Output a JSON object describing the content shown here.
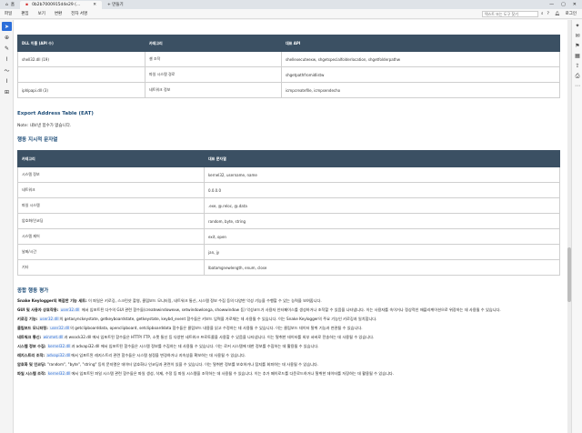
{
  "titlebar": {
    "home_tab": "홈",
    "doc_tab": "0b2b7000915d4e29 (...",
    "new_tab": "+ 만들기"
  },
  "menubar": {
    "items": [
      "파일",
      "편집",
      "보기",
      "변환",
      "전자 서명"
    ],
    "search_placeholder": "텍스트 또는 도구 찾기",
    "login": "로그인"
  },
  "dll_table": {
    "headers": [
      "DLL 이름 (API 수)",
      "카테고리",
      "대표 API"
    ],
    "rows": [
      [
        "shell32.dll (19)",
        "셸 조작",
        "shellexecuteexw, shgetspecialfolderlocation, shgetfolderpathw"
      ],
      [
        "",
        "파일 시스템 경로",
        "shgetpathfromidlistw"
      ],
      [
        "iphlpapi.dll (3)",
        "네트워크 정보",
        "icmpcreatefile, icmpsendecho"
      ]
    ]
  },
  "eat": {
    "heading": "Export Address Table (EAT)",
    "note": "Note: 내보낸 함수가 없습니다."
  },
  "behavior": {
    "heading": "행동 지시적 문자열",
    "headers": [
      "카테고리",
      "대표 문자열"
    ],
    "rows": [
      [
        "시스템 정보",
        "kernel32, username, name"
      ],
      [
        "네트워크",
        "0.0.0.0"
      ],
      [
        "파일 시스템",
        ".exe, @.reloc, @.data"
      ],
      [
        "암호화/인코딩",
        "random, byte, string"
      ],
      [
        "시스템 제어",
        "exit, open"
      ],
      [
        "날짜/시간",
        "jan, jy"
      ],
      [
        "기타",
        "lbatamgnewlength, enum, close"
      ]
    ]
  },
  "summary": {
    "heading": "종합 행동 평가",
    "paragraphs": [
      {
        "label": "Snake Keylogger의 복잡한 기능 세트:",
        "text": " 이 파일은 키로깅, 스크린샷 촬영, 클립보드 모니터링, 네트워크 통신, 시스템 정보 수집 등의 다양한 악성 기능을 수행할 수 있는 능력을 보여줍니다."
      },
      {
        "label": "GUI 및 사용자 상호작용:",
        "code": "user32.dll",
        "text": "에서 임포트된 다수의 GUI 관련 함수들(createwindowexw, setwindowlonga, showwindow 등) 악성코드가 사용자 인터페이스를 생성하거나 조작할 수 있음을 나타냅니다. 이는 사용자를 속이거나 정상적인 애플리케이션으로 위장하는 데 사용될 수 있습니다."
      },
      {
        "label": "키로깅 기능:",
        "code": "user32.dll",
        "text": "의 getasynckeystate, getkeyboardstate, getkeystate, keybd_event 함수들은 키보드 입력을 가로채는 데 사용될 수 있습니다. 이는 Snake Keylogger의 주요 기능인 키로깅과 일치합니다."
      },
      {
        "label": "클립보드 모니터링:",
        "code": "user32.dll",
        "text": "의 getclipboarddata, openclipboard, setclipboarddata 함수들은 클립보드 내용을 읽고 수정하는 데 사용될 수 있습니다. 이는 클립보드 데이터 탈취 기능과 연관될 수 있습니다."
      },
      {
        "label": "네트워크 통신:",
        "code": "winmet.dll",
        "text": "과 wsock32.dll 에서 임포트된 함수들은 HTTP/ FTP, 소켓 통신 등 다양한 네트워크 프로토콜을 사용할 수 있음을 나타냅니다. 이는 탈취한 데이터를 외부 서버로 전송하는 데 사용될 수 있습니다."
      },
      {
        "label": "시스템 정보 수집:",
        "code": "kernel32.dll",
        "text": "과 advapi32.dll 에서 임포트된 함수들은 시스템 정보를 수집하는 데 사용될 수 있습니다. 이는 로커 시스템에 대한 정보를 수집하는 데 활용될 수 있습니다."
      },
      {
        "label": "레지스트리 조작:",
        "code": "advapi32.dll",
        "text": "에서 임포트된 레지스트리 관련 함수들은 시스템 설정을 변경하거나 지속성을 확보하는 데 사용될 수 있습니다."
      },
      {
        "label": "암호화 및 인코딩:",
        "code": "",
        "text": "\"random\", \"byte\", \"string\" 등의 문자열은 데이터 암호화나 인코딩과 관련이 있을 수 있습니다. 이는 탈취한 정보를 보호하거나 탐지를 회피하는 데 사용될 수 있습니다."
      },
      {
        "label": "파일 시스템 조작:",
        "code": "kernel32.dll",
        "text": "에서 임포트된 파일 시스템 관련 함수들은 파일 생성, 삭제, 수정 등 파일 시스템을 조작하는 데 사용될 수 있습니다. 이는 추가 페이로드를 다운로드하거나 탈취한 데이터를 저장하는 데 활용될 수 있습니다."
      }
    ]
  }
}
